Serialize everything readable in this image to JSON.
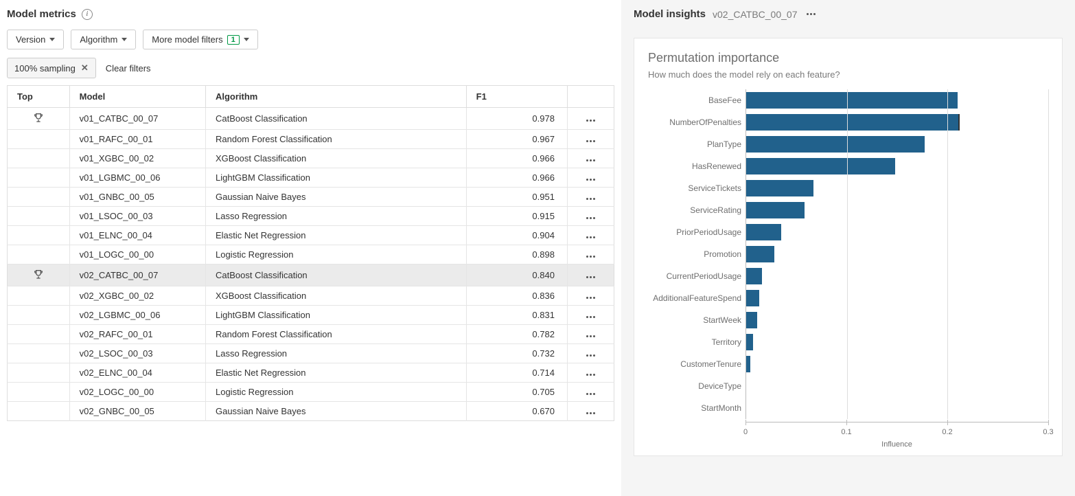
{
  "metrics": {
    "title": "Model metrics",
    "filters": {
      "version": "Version",
      "algorithm": "Algorithm",
      "more": "More model filters",
      "more_count": "1"
    },
    "chip_label": "100% sampling",
    "clear_label": "Clear filters",
    "columns": {
      "top": "Top",
      "model": "Model",
      "algorithm": "Algorithm",
      "f1": "F1"
    },
    "rows": [
      {
        "trophy": true,
        "model": "v01_CATBC_00_07",
        "algorithm": "CatBoost Classification",
        "f1": "0.978",
        "selected": false
      },
      {
        "trophy": false,
        "model": "v01_RAFC_00_01",
        "algorithm": "Random Forest Classification",
        "f1": "0.967",
        "selected": false
      },
      {
        "trophy": false,
        "model": "v01_XGBC_00_02",
        "algorithm": "XGBoost Classification",
        "f1": "0.966",
        "selected": false
      },
      {
        "trophy": false,
        "model": "v01_LGBMC_00_06",
        "algorithm": "LightGBM Classification",
        "f1": "0.966",
        "selected": false
      },
      {
        "trophy": false,
        "model": "v01_GNBC_00_05",
        "algorithm": "Gaussian Naive Bayes",
        "f1": "0.951",
        "selected": false
      },
      {
        "trophy": false,
        "model": "v01_LSOC_00_03",
        "algorithm": "Lasso Regression",
        "f1": "0.915",
        "selected": false
      },
      {
        "trophy": false,
        "model": "v01_ELNC_00_04",
        "algorithm": "Elastic Net Regression",
        "f1": "0.904",
        "selected": false
      },
      {
        "trophy": false,
        "model": "v01_LOGC_00_00",
        "algorithm": "Logistic Regression",
        "f1": "0.898",
        "selected": false
      },
      {
        "trophy": true,
        "model": "v02_CATBC_00_07",
        "algorithm": "CatBoost Classification",
        "f1": "0.840",
        "selected": true
      },
      {
        "trophy": false,
        "model": "v02_XGBC_00_02",
        "algorithm": "XGBoost Classification",
        "f1": "0.836",
        "selected": false
      },
      {
        "trophy": false,
        "model": "v02_LGBMC_00_06",
        "algorithm": "LightGBM Classification",
        "f1": "0.831",
        "selected": false
      },
      {
        "trophy": false,
        "model": "v02_RAFC_00_01",
        "algorithm": "Random Forest Classification",
        "f1": "0.782",
        "selected": false
      },
      {
        "trophy": false,
        "model": "v02_LSOC_00_03",
        "algorithm": "Lasso Regression",
        "f1": "0.732",
        "selected": false
      },
      {
        "trophy": false,
        "model": "v02_ELNC_00_04",
        "algorithm": "Elastic Net Regression",
        "f1": "0.714",
        "selected": false
      },
      {
        "trophy": false,
        "model": "v02_LOGC_00_00",
        "algorithm": "Logistic Regression",
        "f1": "0.705",
        "selected": false
      },
      {
        "trophy": false,
        "model": "v02_GNBC_00_05",
        "algorithm": "Gaussian Naive Bayes",
        "f1": "0.670",
        "selected": false
      }
    ]
  },
  "insights": {
    "title": "Model insights",
    "subtitle": "v02_CATBC_00_07",
    "chart_title": "Permutation importance",
    "chart_subtitle": "How much does the model rely on each feature?",
    "xlabel": "Influence"
  },
  "chart_data": {
    "type": "bar",
    "orientation": "horizontal",
    "xlabel": "Influence",
    "xlim": [
      0,
      0.3
    ],
    "ticks": [
      0,
      0.1,
      0.2,
      0.3
    ],
    "categories": [
      "BaseFee",
      "NumberOfPenalties",
      "PlanType",
      "HasRenewed",
      "ServiceTickets",
      "ServiceRating",
      "PriorPeriodUsage",
      "Promotion",
      "CurrentPeriodUsage",
      "AdditionalFeatureSpend",
      "StartWeek",
      "Territory",
      "CustomerTenure",
      "DeviceType",
      "StartMonth"
    ],
    "values": [
      0.21,
      0.212,
      0.177,
      0.148,
      0.067,
      0.058,
      0.035,
      0.028,
      0.016,
      0.013,
      0.011,
      0.007,
      0.004,
      0.0,
      0.0
    ],
    "highlight_index": 1
  }
}
